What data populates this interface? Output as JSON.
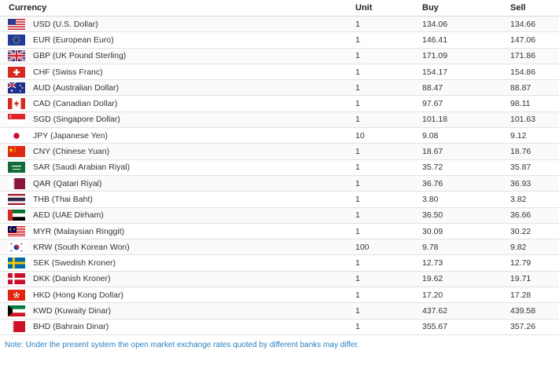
{
  "headers": {
    "currency": "Currency",
    "unit": "Unit",
    "buy": "Buy",
    "sell": "Sell"
  },
  "rows": [
    {
      "flag": "us-flag-icon",
      "name": "USD (U.S. Dollar)",
      "unit": "1",
      "buy": "134.06",
      "sell": "134.66"
    },
    {
      "flag": "eu-flag-icon",
      "name": "EUR (European Euro)",
      "unit": "1",
      "buy": "146.41",
      "sell": "147.06"
    },
    {
      "flag": "uk-flag-icon",
      "name": "GBP (UK Pound Sterling)",
      "unit": "1",
      "buy": "171.09",
      "sell": "171.86"
    },
    {
      "flag": "ch-flag-icon",
      "name": "CHF (Swiss Franc)",
      "unit": "1",
      "buy": "154.17",
      "sell": "154.86"
    },
    {
      "flag": "au-flag-icon",
      "name": "AUD (Australian Dollar)",
      "unit": "1",
      "buy": "88.47",
      "sell": "88.87"
    },
    {
      "flag": "ca-flag-icon",
      "name": "CAD (Canadian Dollar)",
      "unit": "1",
      "buy": "97.67",
      "sell": "98.11"
    },
    {
      "flag": "sg-flag-icon",
      "name": "SGD (Singapore Dollar)",
      "unit": "1",
      "buy": "101.18",
      "sell": "101.63"
    },
    {
      "flag": "jp-flag-icon",
      "name": "JPY (Japanese Yen)",
      "unit": "10",
      "buy": "9.08",
      "sell": "9.12"
    },
    {
      "flag": "cn-flag-icon",
      "name": "CNY (Chinese Yuan)",
      "unit": "1",
      "buy": "18.67",
      "sell": "18.76"
    },
    {
      "flag": "sa-flag-icon",
      "name": "SAR (Saudi Arabian Riyal)",
      "unit": "1",
      "buy": "35.72",
      "sell": "35.87"
    },
    {
      "flag": "qa-flag-icon",
      "name": "QAR (Qatari Riyal)",
      "unit": "1",
      "buy": "36.76",
      "sell": "36.93"
    },
    {
      "flag": "th-flag-icon",
      "name": "THB (Thai Baht)",
      "unit": "1",
      "buy": "3.80",
      "sell": "3.82"
    },
    {
      "flag": "ae-flag-icon",
      "name": "AED (UAE Dirham)",
      "unit": "1",
      "buy": "36.50",
      "sell": "36.66"
    },
    {
      "flag": "my-flag-icon",
      "name": "MYR (Malaysian Ringgit)",
      "unit": "1",
      "buy": "30.09",
      "sell": "30.22"
    },
    {
      "flag": "kr-flag-icon",
      "name": "KRW (South Korean Won)",
      "unit": "100",
      "buy": "9.78",
      "sell": "9.82"
    },
    {
      "flag": "se-flag-icon",
      "name": "SEK (Swedish Kroner)",
      "unit": "1",
      "buy": "12.73",
      "sell": "12.79"
    },
    {
      "flag": "dk-flag-icon",
      "name": "DKK (Danish Kroner)",
      "unit": "1",
      "buy": "19.62",
      "sell": "19.71"
    },
    {
      "flag": "hk-flag-icon",
      "name": "HKD (Hong Kong Dollar)",
      "unit": "1",
      "buy": "17.20",
      "sell": "17.28"
    },
    {
      "flag": "kw-flag-icon",
      "name": "KWD (Kuwaity Dinar)",
      "unit": "1",
      "buy": "437.62",
      "sell": "439.58"
    },
    {
      "flag": "bh-flag-icon",
      "name": "BHD (Bahrain Dinar)",
      "unit": "1",
      "buy": "355.67",
      "sell": "357.26"
    }
  ],
  "note": "Note: Under the present system the open market exchange rates quoted by different banks may differ.",
  "colors": {
    "note_text": "#2a7fc0",
    "row_border": "#e2e2e2"
  }
}
